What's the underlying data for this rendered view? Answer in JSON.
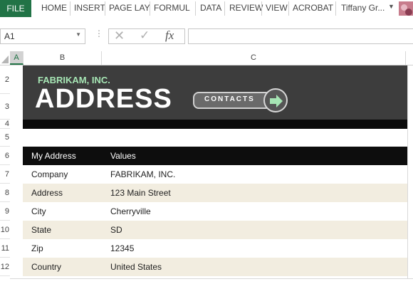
{
  "ribbon": {
    "file": "FILE",
    "tabs": [
      "HOME",
      "INSERT",
      "PAGE LAY",
      "FORMUL",
      "DATA",
      "REVIEW",
      "VIEW",
      "ACROBAT"
    ],
    "user": "Tiffany Gr..."
  },
  "formula_bar": {
    "name_box": "A1",
    "fx": "fx",
    "formula": ""
  },
  "columns": [
    "A",
    "B",
    "C"
  ],
  "rows": [
    "2",
    "3",
    "4",
    "5",
    "6",
    "7",
    "8",
    "9",
    "10",
    "11",
    "12"
  ],
  "banner": {
    "company": "FABRIKAM, INC.",
    "title": "ADDRESS",
    "button": "CONTACTS"
  },
  "table": {
    "headers": [
      "My Address",
      "Values"
    ],
    "rows": [
      [
        "Company",
        "FABRIKAM, INC."
      ],
      [
        "Address",
        "123 Main Street"
      ],
      [
        "City",
        "Cherryville"
      ],
      [
        "State",
        "SD"
      ],
      [
        "Zip",
        "12345"
      ],
      [
        "Country",
        "United States"
      ]
    ]
  },
  "colors": {
    "excel_green": "#217346",
    "banner_bg": "#3d3d3d",
    "company_text": "#a6e5b4",
    "alt_row": "#f2ede0"
  }
}
